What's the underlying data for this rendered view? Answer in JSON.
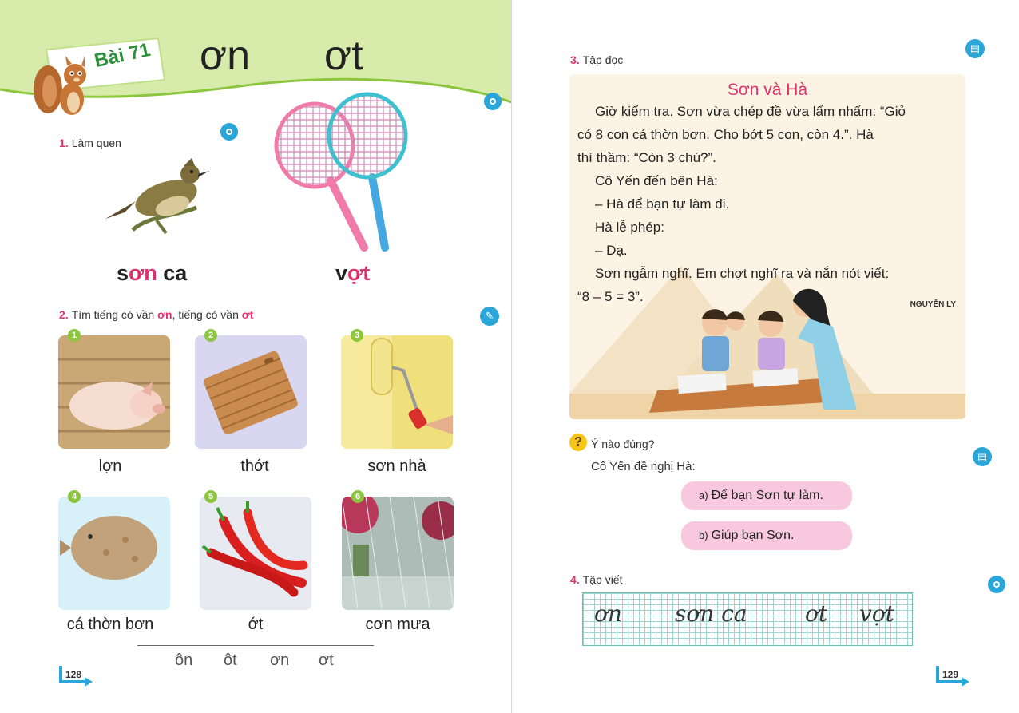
{
  "left_page": {
    "lesson_label": "Bài 71",
    "rhyme_1": "ơn",
    "rhyme_2": "ơt",
    "section1": {
      "num": "1.",
      "label": "Làm quen"
    },
    "word1": {
      "part_a": "s",
      "part_hl": "ơn",
      "part_b": " ca"
    },
    "word2": {
      "part_a": "v",
      "part_hl": "ợt",
      "part_b": ""
    },
    "section2": {
      "num": "2.",
      "pre": "Tìm tiếng có vần ",
      "hl1": "ơn",
      "mid": ", tiếng có vần ",
      "hl2": "ơt"
    },
    "tiles": [
      {
        "n": "1",
        "caption": "lợn"
      },
      {
        "n": "2",
        "caption": "thớt"
      },
      {
        "n": "3",
        "caption": "sơn nhà"
      },
      {
        "n": "4",
        "caption": "cá thờn bơn"
      },
      {
        "n": "5",
        "caption": "ớt"
      },
      {
        "n": "6",
        "caption": "cơn mưa"
      }
    ],
    "options": [
      "ôn",
      "ôt",
      "ơn",
      "ơt"
    ],
    "page_number": "128"
  },
  "right_page": {
    "section3": {
      "num": "3.",
      "label": "Tập đọc"
    },
    "story_title": "Sơn và Hà",
    "story_lines": [
      "Giờ kiểm tra. Sơn vừa chép đề vừa lẩm nhẩm: “Giỏ",
      "có 8 con cá thờn bơn. Cho bớt 5 con, còn 4.”. Hà",
      "thì thầm: “Còn 3 chú?”.",
      "Cô Yến đến bên Hà:",
      "– Hà để bạn tự làm đi.",
      "Hà lễ phép:",
      "– Dạ.",
      "Sơn ngẫm nghĩ. Em chợt nghĩ ra và nắn nót viết:",
      "“8 – 5 = 3”."
    ],
    "author": "NGUYỄN LY",
    "question": {
      "icon": "?",
      "label": "Ý nào đúng?",
      "prompt": "Cô Yến đề nghị Hà:"
    },
    "answers": [
      {
        "letter": "a)",
        "text": "Để bạn Sơn tự làm."
      },
      {
        "letter": "b)",
        "text": "Giúp bạn Sơn."
      }
    ],
    "section4": {
      "num": "4.",
      "label": "Tập viết"
    },
    "handwriting": [
      "ơn",
      "sơn ca",
      "ơt",
      "vợt"
    ],
    "page_number": "129"
  },
  "colors": {
    "accent_pink": "#e0306b",
    "band_green": "#d7ebaa",
    "icon_blue": "#2aa6d8",
    "answer_pink": "#f8c8de"
  },
  "icons": [
    "audio-play-icon",
    "document-icon",
    "edit-icon",
    "question-icon",
    "page-arrow-icon",
    "squirrel-mascot"
  ]
}
